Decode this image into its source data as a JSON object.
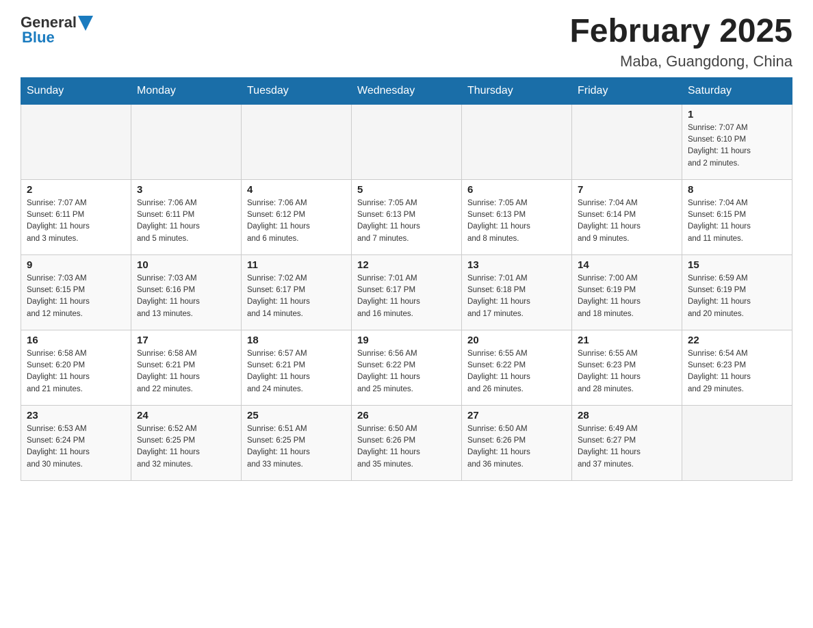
{
  "header": {
    "logo_general": "General",
    "logo_blue": "Blue",
    "title": "February 2025",
    "subtitle": "Maba, Guangdong, China"
  },
  "days_of_week": [
    "Sunday",
    "Monday",
    "Tuesday",
    "Wednesday",
    "Thursday",
    "Friday",
    "Saturday"
  ],
  "weeks": [
    [
      {
        "day": "",
        "info": ""
      },
      {
        "day": "",
        "info": ""
      },
      {
        "day": "",
        "info": ""
      },
      {
        "day": "",
        "info": ""
      },
      {
        "day": "",
        "info": ""
      },
      {
        "day": "",
        "info": ""
      },
      {
        "day": "1",
        "info": "Sunrise: 7:07 AM\nSunset: 6:10 PM\nDaylight: 11 hours\nand 2 minutes."
      }
    ],
    [
      {
        "day": "2",
        "info": "Sunrise: 7:07 AM\nSunset: 6:11 PM\nDaylight: 11 hours\nand 3 minutes."
      },
      {
        "day": "3",
        "info": "Sunrise: 7:06 AM\nSunset: 6:11 PM\nDaylight: 11 hours\nand 5 minutes."
      },
      {
        "day": "4",
        "info": "Sunrise: 7:06 AM\nSunset: 6:12 PM\nDaylight: 11 hours\nand 6 minutes."
      },
      {
        "day": "5",
        "info": "Sunrise: 7:05 AM\nSunset: 6:13 PM\nDaylight: 11 hours\nand 7 minutes."
      },
      {
        "day": "6",
        "info": "Sunrise: 7:05 AM\nSunset: 6:13 PM\nDaylight: 11 hours\nand 8 minutes."
      },
      {
        "day": "7",
        "info": "Sunrise: 7:04 AM\nSunset: 6:14 PM\nDaylight: 11 hours\nand 9 minutes."
      },
      {
        "day": "8",
        "info": "Sunrise: 7:04 AM\nSunset: 6:15 PM\nDaylight: 11 hours\nand 11 minutes."
      }
    ],
    [
      {
        "day": "9",
        "info": "Sunrise: 7:03 AM\nSunset: 6:15 PM\nDaylight: 11 hours\nand 12 minutes."
      },
      {
        "day": "10",
        "info": "Sunrise: 7:03 AM\nSunset: 6:16 PM\nDaylight: 11 hours\nand 13 minutes."
      },
      {
        "day": "11",
        "info": "Sunrise: 7:02 AM\nSunset: 6:17 PM\nDaylight: 11 hours\nand 14 minutes."
      },
      {
        "day": "12",
        "info": "Sunrise: 7:01 AM\nSunset: 6:17 PM\nDaylight: 11 hours\nand 16 minutes."
      },
      {
        "day": "13",
        "info": "Sunrise: 7:01 AM\nSunset: 6:18 PM\nDaylight: 11 hours\nand 17 minutes."
      },
      {
        "day": "14",
        "info": "Sunrise: 7:00 AM\nSunset: 6:19 PM\nDaylight: 11 hours\nand 18 minutes."
      },
      {
        "day": "15",
        "info": "Sunrise: 6:59 AM\nSunset: 6:19 PM\nDaylight: 11 hours\nand 20 minutes."
      }
    ],
    [
      {
        "day": "16",
        "info": "Sunrise: 6:58 AM\nSunset: 6:20 PM\nDaylight: 11 hours\nand 21 minutes."
      },
      {
        "day": "17",
        "info": "Sunrise: 6:58 AM\nSunset: 6:21 PM\nDaylight: 11 hours\nand 22 minutes."
      },
      {
        "day": "18",
        "info": "Sunrise: 6:57 AM\nSunset: 6:21 PM\nDaylight: 11 hours\nand 24 minutes."
      },
      {
        "day": "19",
        "info": "Sunrise: 6:56 AM\nSunset: 6:22 PM\nDaylight: 11 hours\nand 25 minutes."
      },
      {
        "day": "20",
        "info": "Sunrise: 6:55 AM\nSunset: 6:22 PM\nDaylight: 11 hours\nand 26 minutes."
      },
      {
        "day": "21",
        "info": "Sunrise: 6:55 AM\nSunset: 6:23 PM\nDaylight: 11 hours\nand 28 minutes."
      },
      {
        "day": "22",
        "info": "Sunrise: 6:54 AM\nSunset: 6:23 PM\nDaylight: 11 hours\nand 29 minutes."
      }
    ],
    [
      {
        "day": "23",
        "info": "Sunrise: 6:53 AM\nSunset: 6:24 PM\nDaylight: 11 hours\nand 30 minutes."
      },
      {
        "day": "24",
        "info": "Sunrise: 6:52 AM\nSunset: 6:25 PM\nDaylight: 11 hours\nand 32 minutes."
      },
      {
        "day": "25",
        "info": "Sunrise: 6:51 AM\nSunset: 6:25 PM\nDaylight: 11 hours\nand 33 minutes."
      },
      {
        "day": "26",
        "info": "Sunrise: 6:50 AM\nSunset: 6:26 PM\nDaylight: 11 hours\nand 35 minutes."
      },
      {
        "day": "27",
        "info": "Sunrise: 6:50 AM\nSunset: 6:26 PM\nDaylight: 11 hours\nand 36 minutes."
      },
      {
        "day": "28",
        "info": "Sunrise: 6:49 AM\nSunset: 6:27 PM\nDaylight: 11 hours\nand 37 minutes."
      },
      {
        "day": "",
        "info": ""
      }
    ]
  ]
}
